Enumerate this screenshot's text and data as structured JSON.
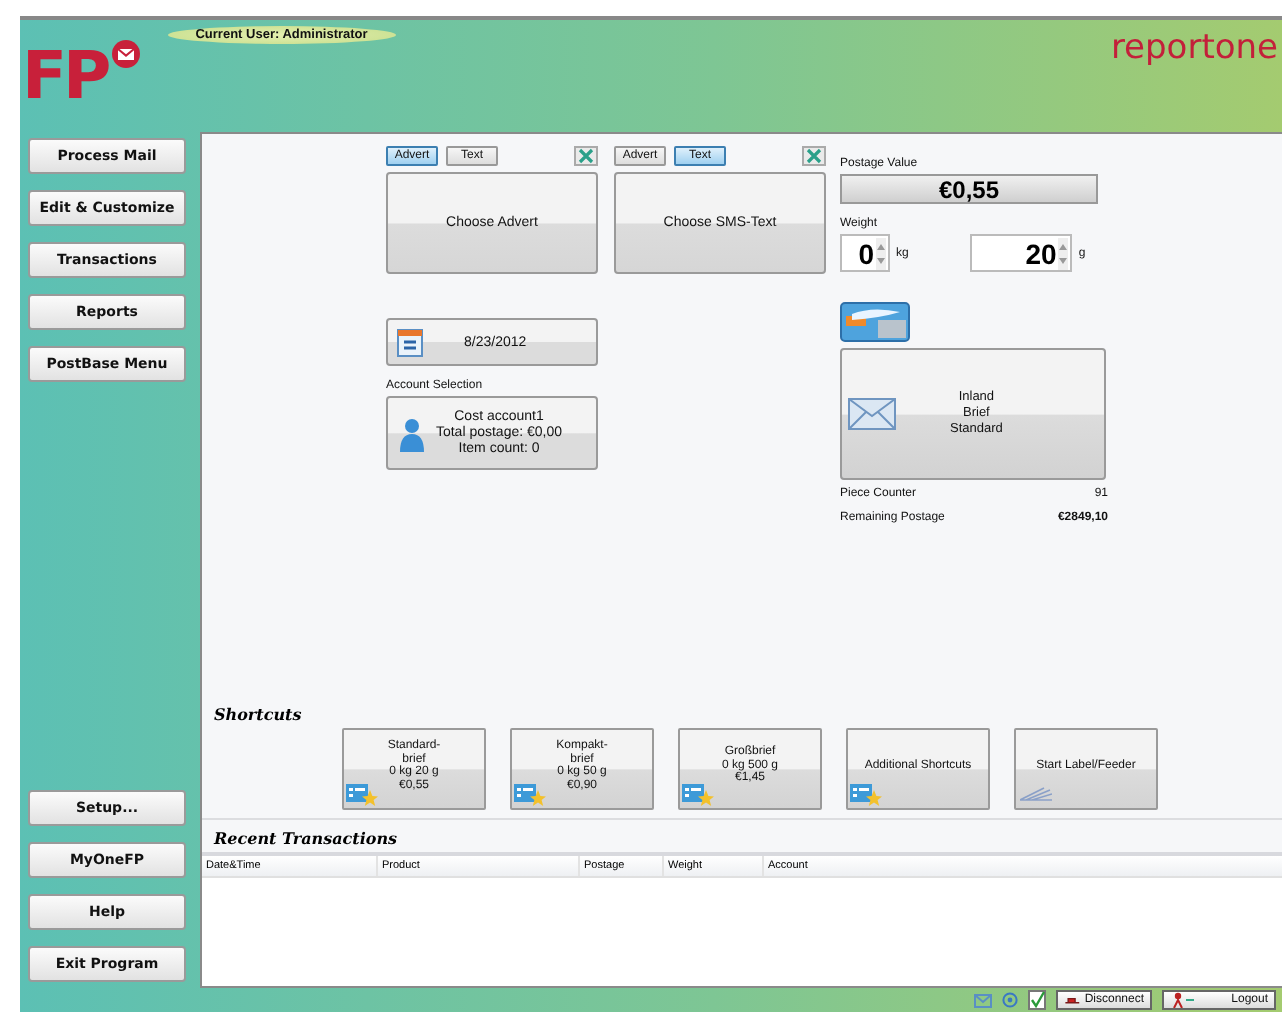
{
  "header": {
    "logo_text": "FP",
    "current_user": "Current User: Administrator",
    "brand": "reportone"
  },
  "nav_top": [
    {
      "label": "Process Mail"
    },
    {
      "label": "Edit & Customize"
    },
    {
      "label": "Transactions"
    },
    {
      "label": "Reports"
    },
    {
      "label": "PostBase Menu"
    }
  ],
  "nav_bottom": [
    {
      "label": "Setup..."
    },
    {
      "label": "MyOneFP"
    },
    {
      "label": "Help"
    },
    {
      "label": "Exit Program"
    }
  ],
  "message_panels": [
    {
      "tabs": [
        {
          "label": "Advert",
          "selected": true
        },
        {
          "label": "Text",
          "selected": false
        }
      ],
      "button": "Choose Advert"
    },
    {
      "tabs": [
        {
          "label": "Advert",
          "selected": false
        },
        {
          "label": "Text",
          "selected": true
        }
      ],
      "button": "Choose SMS-Text"
    }
  ],
  "date": "8/23/2012",
  "account": {
    "label": "Account Selection",
    "lines": [
      "Cost account1",
      "Total postage: €0,00",
      "Item count: 0"
    ]
  },
  "postage": {
    "label": "Postage Value",
    "value": "€0,55"
  },
  "weight": {
    "label": "Weight",
    "fields": [
      {
        "value": "0",
        "unit": "kg"
      },
      {
        "value": "20",
        "unit": "g"
      }
    ]
  },
  "product": {
    "lines": [
      "Inland",
      "Brief",
      "Standard"
    ]
  },
  "counters": [
    {
      "label": "Piece Counter",
      "value": "91",
      "bold": false
    },
    {
      "label": "Remaining Postage",
      "value": "€2849,10",
      "bold": true
    }
  ],
  "shortcuts": {
    "title": "Shortcuts",
    "items": [
      {
        "kind": "product",
        "lines": [
          "Standard-",
          "brief",
          "0 kg 20 g",
          "€0,55"
        ]
      },
      {
        "kind": "product",
        "lines": [
          "Kompakt-",
          "brief",
          "0 kg 50 g",
          "€0,90"
        ]
      },
      {
        "kind": "product",
        "lines": [
          "Großbrief",
          "0 kg 500 g",
          "€1,45"
        ]
      },
      {
        "kind": "product",
        "lines": [
          "Additional Shortcuts"
        ]
      },
      {
        "kind": "feeder",
        "lines": [
          "Start Label/Feeder"
        ]
      }
    ]
  },
  "transactions": {
    "title": "Recent Transactions",
    "columns": [
      "Date&Time",
      "Product",
      "Postage",
      "Weight",
      "Account"
    ]
  },
  "status_bar": {
    "buttons": [
      {
        "kind": "disconnect",
        "label": "Disconnect"
      },
      {
        "kind": "logout",
        "label": "Logout"
      }
    ]
  }
}
